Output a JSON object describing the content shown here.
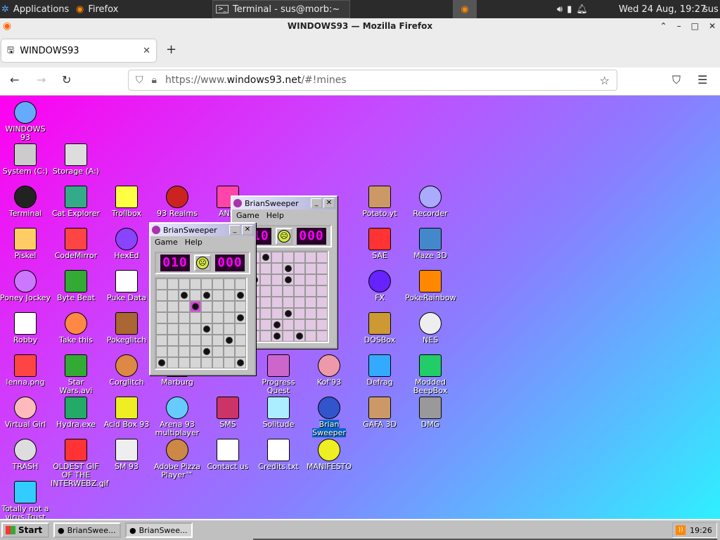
{
  "system_panel": {
    "apps_label": "Applications",
    "firefox_task": "Firefox",
    "terminal_task": "Terminal - sus@morb:~",
    "clock": "Wed 24 Aug, 19:27",
    "user": "sus"
  },
  "firefox": {
    "window_title": "WINDOWS93 — Mozilla Firefox",
    "tab_label": "WINDOWS93",
    "url_prefix": "https://www.",
    "url_host": "windows93.net",
    "url_path": "/#!mines"
  },
  "desktop": {
    "icons": [
      {
        "label": "WINDOWS 93",
        "icon": "computer-icon"
      },
      {
        "label": "System (C:)",
        "icon": "drive-icon"
      },
      {
        "label": "Storage (A:)",
        "icon": "floppy-icon"
      },
      {
        "label": "Terminal",
        "icon": "terminal-icon"
      },
      {
        "label": "Cat Explorer",
        "icon": "globe-icon"
      },
      {
        "label": "Trollbox",
        "icon": "chat-icon"
      },
      {
        "label": "93 Realms",
        "icon": "knight-icon"
      },
      {
        "label": "ANSI",
        "icon": "ansi-icon"
      },
      {
        "label": "Potato.yt",
        "icon": "potato-icon"
      },
      {
        "label": "Recorder",
        "icon": "microphone-icon"
      },
      {
        "label": "Piskel",
        "icon": "palette-icon"
      },
      {
        "label": "CodeMirror",
        "icon": "code-icon"
      },
      {
        "label": "HexEd",
        "icon": "hex-icon"
      },
      {
        "label": "SAE",
        "icon": "ball-icon"
      },
      {
        "label": "Maze 3D",
        "icon": "maze-icon"
      },
      {
        "label": "Poney Jockey",
        "icon": "pony-icon"
      },
      {
        "label": "Byte Beat",
        "icon": "bytebeat-icon"
      },
      {
        "label": "Puke Data",
        "icon": "pd-icon"
      },
      {
        "label": "FX",
        "icon": "atom-icon"
      },
      {
        "label": "PokeRainbow",
        "icon": "pokemon-icon"
      },
      {
        "label": "Robby",
        "icon": "robot-icon"
      },
      {
        "label": "Take this",
        "icon": "clown-icon"
      },
      {
        "label": "Pokeglitch",
        "icon": "glitch-icon"
      },
      {
        "label": "DOSBox",
        "icon": "dosbox-icon"
      },
      {
        "label": "NES",
        "icon": "nes-icon"
      },
      {
        "label": "lenna.png",
        "icon": "image-file-icon"
      },
      {
        "label": "Star Wars.avi",
        "icon": "yoda-icon"
      },
      {
        "label": "Corglitch",
        "icon": "corgi-icon"
      },
      {
        "label": "Marburg",
        "icon": "marburg-icon"
      },
      {
        "label": "Progress Quest",
        "icon": "sword-icon"
      },
      {
        "label": "Kof'93",
        "icon": "fighter-icon"
      },
      {
        "label": "Defrag",
        "icon": "defrag-icon"
      },
      {
        "label": "Modded BeepBox",
        "icon": "beepbox-icon"
      },
      {
        "label": "Virtual Girl",
        "icon": "face-icon"
      },
      {
        "label": "Hydra.exe",
        "icon": "hydra-icon"
      },
      {
        "label": "Acid Box 93",
        "icon": "smiley-icon"
      },
      {
        "label": "Arena 93 multiplayer",
        "icon": "cube-icon"
      },
      {
        "label": "SMS",
        "icon": "sms-icon"
      },
      {
        "label": "Solitude",
        "icon": "jar-icon"
      },
      {
        "label": "Brian Sweeper",
        "icon": "mine-icon"
      },
      {
        "label": "GAFA 3D",
        "icon": "doom-icon"
      },
      {
        "label": "DMG",
        "icon": "gameboy-icon"
      },
      {
        "label": "TRASH",
        "icon": "trash-icon"
      },
      {
        "label": "OLDEST GIF OF THE INTERWEBZ.gif",
        "icon": "gif-file-icon"
      },
      {
        "label": "SM 93",
        "icon": "book-icon"
      },
      {
        "label": "Adobe Pizza Player™",
        "icon": "pizza-icon"
      },
      {
        "label": "Contact us",
        "icon": "contact-icon"
      },
      {
        "label": "Credits.txt",
        "icon": "text-file-icon"
      },
      {
        "label": "MANIFESTO",
        "icon": "question-icon"
      },
      {
        "label": "Totally not a virus.Trust",
        "icon": "dolphin-icon"
      }
    ]
  },
  "windows": {
    "front": {
      "title": "BrianSweeper",
      "menu_game": "Game",
      "menu_help": "Help",
      "mines_left": "010",
      "timer": "000"
    },
    "back": {
      "title": "BrianSweeper",
      "menu_game": "Game",
      "menu_help": "Help",
      "mines_left": "010",
      "timer": "000"
    }
  },
  "taskbar": {
    "start_label": "Start",
    "task1": "BrianSwee...",
    "task2": "BrianSwee...",
    "tray_time": "19:26"
  },
  "colors": {
    "lcd_fg": "#ff00ff",
    "highlight": "#0a64c8"
  }
}
